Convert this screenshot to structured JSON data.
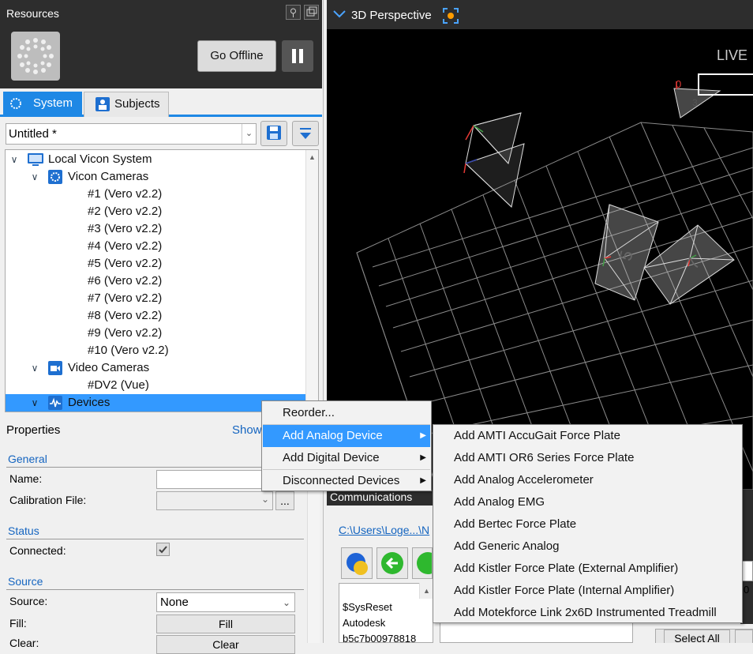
{
  "resources": {
    "title": "Resources",
    "go_offline": "Go Offline"
  },
  "tabs": [
    {
      "label": "System"
    },
    {
      "label": "Subjects"
    }
  ],
  "config": {
    "value": "Untitled *"
  },
  "tree": {
    "system": "Local Vicon System",
    "vicon_cameras": "Vicon Cameras",
    "cameras": [
      "#1 (Vero v2.2)",
      "#2 (Vero v2.2)",
      "#3 (Vero v2.2)",
      "#4 (Vero v2.2)",
      "#5 (Vero v2.2)",
      "#6 (Vero v2.2)",
      "#7 (Vero v2.2)",
      "#8 (Vero v2.2)",
      "#9 (Vero v2.2)",
      "#10 (Vero v2.2)"
    ],
    "video_cameras": "Video Cameras",
    "video_items": [
      "#DV2 (Vue)"
    ],
    "devices": "Devices"
  },
  "properties": {
    "title": "Properties",
    "show": "Show",
    "general": "General",
    "name_label": "Name:",
    "calibration_label": "Calibration File:",
    "browse": "...",
    "status": "Status",
    "connected_label": "Connected:",
    "source_section": "Source",
    "source_label": "Source:",
    "source_value": "None",
    "fill_label": "Fill:",
    "fill_button": "Fill",
    "clear_label": "Clear:",
    "clear_button": "Clear"
  },
  "viewport": {
    "title": "3D Perspective",
    "live": "LIVE",
    "camera_labels": [
      "0",
      "3",
      "5",
      "7"
    ]
  },
  "communications": {
    "title": "Communications",
    "path": "C:\\Users\\Loge...\\N",
    "log": [
      "$SysReset",
      "Autodesk",
      "b5c7b00978818"
    ],
    "select_all": "Select All",
    "right_digit": "0"
  },
  "context_menu": {
    "items": [
      "Reorder...",
      "Add Analog Device",
      "Add Digital Device",
      "Disconnected Devices"
    ]
  },
  "submenu": {
    "items": [
      "Add AMTI AccuGait Force Plate",
      "Add AMTI OR6 Series Force Plate",
      "Add Analog Accelerometer",
      "Add Analog EMG",
      "Add Bertec Force Plate",
      "Add Generic Analog",
      "Add Kistler Force Plate (External Amplifier)",
      "Add Kistler Force Plate (Internal Amplifier)",
      "Add Motekforce Link 2x6D Instrumented Treadmill"
    ]
  },
  "colors": {
    "accent": "#1e88e5",
    "selection": "#3399ff",
    "panel_dark": "#2d2d2d"
  }
}
